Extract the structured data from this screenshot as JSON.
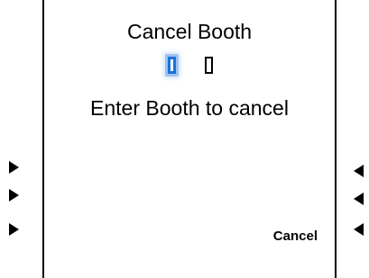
{
  "screen": {
    "title": "Cancel Booth",
    "prompt": "Enter Booth to cancel",
    "booth_input": {
      "digit_count": 2,
      "active_digit_index": 0,
      "values": [
        "",
        ""
      ]
    },
    "softkeys": {
      "right_3_label": "Cancel"
    }
  },
  "colors": {
    "focus_accent": "#1a73d9",
    "text": "#000000",
    "background": "#ffffff"
  },
  "icons": {
    "left_softkeys": "triangle-right-icon",
    "right_softkeys": "triangle-left-icon"
  }
}
